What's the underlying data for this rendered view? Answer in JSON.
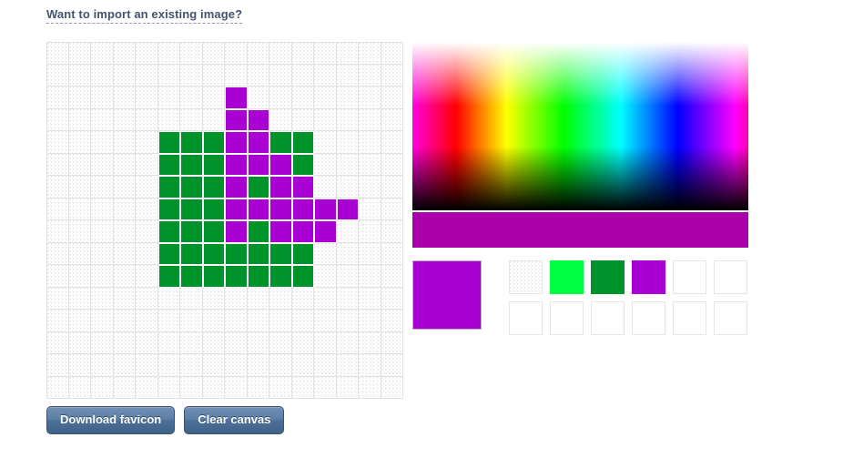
{
  "page": {
    "title": "Favicon Editor",
    "background_color": "#ffffff"
  },
  "import_link": {
    "label": "Want to import an existing image?",
    "color": "#44546e"
  },
  "canvas": {
    "name": "favicon-pixel-canvas",
    "grid_columns": 16,
    "grid_rows": 16,
    "cell_size_px": 24.5,
    "grid_line_color": "#e2e2e2",
    "empty_cell_style": "transparent-checker",
    "palette_used": {
      "green": "#00922b",
      "purple": "#aa00d4"
    },
    "pixels": [
      {
        "row": 2,
        "col": 8,
        "color": "#aa00d4"
      },
      {
        "row": 3,
        "col": 8,
        "color": "#aa00d4"
      },
      {
        "row": 3,
        "col": 9,
        "color": "#aa00d4"
      },
      {
        "row": 4,
        "col": 5,
        "color": "#00922b"
      },
      {
        "row": 4,
        "col": 6,
        "color": "#00922b"
      },
      {
        "row": 4,
        "col": 7,
        "color": "#00922b"
      },
      {
        "row": 4,
        "col": 8,
        "color": "#aa00d4"
      },
      {
        "row": 4,
        "col": 9,
        "color": "#aa00d4"
      },
      {
        "row": 4,
        "col": 10,
        "color": "#00922b"
      },
      {
        "row": 4,
        "col": 11,
        "color": "#00922b"
      },
      {
        "row": 5,
        "col": 5,
        "color": "#00922b"
      },
      {
        "row": 5,
        "col": 6,
        "color": "#00922b"
      },
      {
        "row": 5,
        "col": 7,
        "color": "#00922b"
      },
      {
        "row": 5,
        "col": 8,
        "color": "#aa00d4"
      },
      {
        "row": 5,
        "col": 9,
        "color": "#aa00d4"
      },
      {
        "row": 5,
        "col": 10,
        "color": "#aa00d4"
      },
      {
        "row": 5,
        "col": 11,
        "color": "#00922b"
      },
      {
        "row": 6,
        "col": 5,
        "color": "#00922b"
      },
      {
        "row": 6,
        "col": 6,
        "color": "#00922b"
      },
      {
        "row": 6,
        "col": 7,
        "color": "#00922b"
      },
      {
        "row": 6,
        "col": 8,
        "color": "#aa00d4"
      },
      {
        "row": 6,
        "col": 9,
        "color": "#00922b"
      },
      {
        "row": 6,
        "col": 10,
        "color": "#aa00d4"
      },
      {
        "row": 6,
        "col": 11,
        "color": "#aa00d4"
      },
      {
        "row": 7,
        "col": 5,
        "color": "#00922b"
      },
      {
        "row": 7,
        "col": 6,
        "color": "#00922b"
      },
      {
        "row": 7,
        "col": 7,
        "color": "#00922b"
      },
      {
        "row": 7,
        "col": 8,
        "color": "#aa00d4"
      },
      {
        "row": 7,
        "col": 9,
        "color": "#aa00d4"
      },
      {
        "row": 7,
        "col": 10,
        "color": "#aa00d4"
      },
      {
        "row": 7,
        "col": 11,
        "color": "#aa00d4"
      },
      {
        "row": 7,
        "col": 12,
        "color": "#aa00d4"
      },
      {
        "row": 7,
        "col": 13,
        "color": "#aa00d4"
      },
      {
        "row": 8,
        "col": 5,
        "color": "#00922b"
      },
      {
        "row": 8,
        "col": 6,
        "color": "#00922b"
      },
      {
        "row": 8,
        "col": 7,
        "color": "#00922b"
      },
      {
        "row": 8,
        "col": 8,
        "color": "#aa00d4"
      },
      {
        "row": 8,
        "col": 9,
        "color": "#00922b"
      },
      {
        "row": 8,
        "col": 10,
        "color": "#aa00d4"
      },
      {
        "row": 8,
        "col": 11,
        "color": "#aa00d4"
      },
      {
        "row": 8,
        "col": 12,
        "color": "#aa00d4"
      },
      {
        "row": 9,
        "col": 5,
        "color": "#00922b"
      },
      {
        "row": 9,
        "col": 6,
        "color": "#00922b"
      },
      {
        "row": 9,
        "col": 7,
        "color": "#00922b"
      },
      {
        "row": 9,
        "col": 8,
        "color": "#00922b"
      },
      {
        "row": 9,
        "col": 9,
        "color": "#00922b"
      },
      {
        "row": 9,
        "col": 10,
        "color": "#00922b"
      },
      {
        "row": 9,
        "col": 11,
        "color": "#00922b"
      },
      {
        "row": 10,
        "col": 5,
        "color": "#00922b"
      },
      {
        "row": 10,
        "col": 6,
        "color": "#00922b"
      },
      {
        "row": 10,
        "col": 7,
        "color": "#00922b"
      },
      {
        "row": 10,
        "col": 8,
        "color": "#00922b"
      },
      {
        "row": 10,
        "col": 9,
        "color": "#00922b"
      },
      {
        "row": 10,
        "col": 10,
        "color": "#00922b"
      },
      {
        "row": 10,
        "col": 11,
        "color": "#00922b"
      }
    ]
  },
  "color_picker": {
    "name": "saturation-value-field",
    "hue_stops": [
      "#ff00e0",
      "#ff0000",
      "#ffff00",
      "#00ff00",
      "#00ffff",
      "#0000ff",
      "#ff00ff",
      "#ff00b0"
    ],
    "selected_bar_color": "#aa00aa"
  },
  "current_color": {
    "label": "current-color",
    "value": "#aa00d4"
  },
  "palette": {
    "name": "recent-colors-palette",
    "columns": 6,
    "rows": 2,
    "swatches": [
      {
        "color": "transparent",
        "transparent": true
      },
      {
        "color": "#00ff44",
        "transparent": false
      },
      {
        "color": "#00922b",
        "transparent": false
      },
      {
        "color": "#aa00d4",
        "transparent": false
      },
      {
        "color": "",
        "transparent": false
      },
      {
        "color": "",
        "transparent": false
      },
      {
        "color": "",
        "transparent": false
      },
      {
        "color": "",
        "transparent": false
      },
      {
        "color": "",
        "transparent": false
      },
      {
        "color": "",
        "transparent": false
      },
      {
        "color": "",
        "transparent": false
      },
      {
        "color": "",
        "transparent": false
      }
    ]
  },
  "buttons": {
    "download_label": "Download favicon",
    "clear_label": "Clear canvas"
  }
}
